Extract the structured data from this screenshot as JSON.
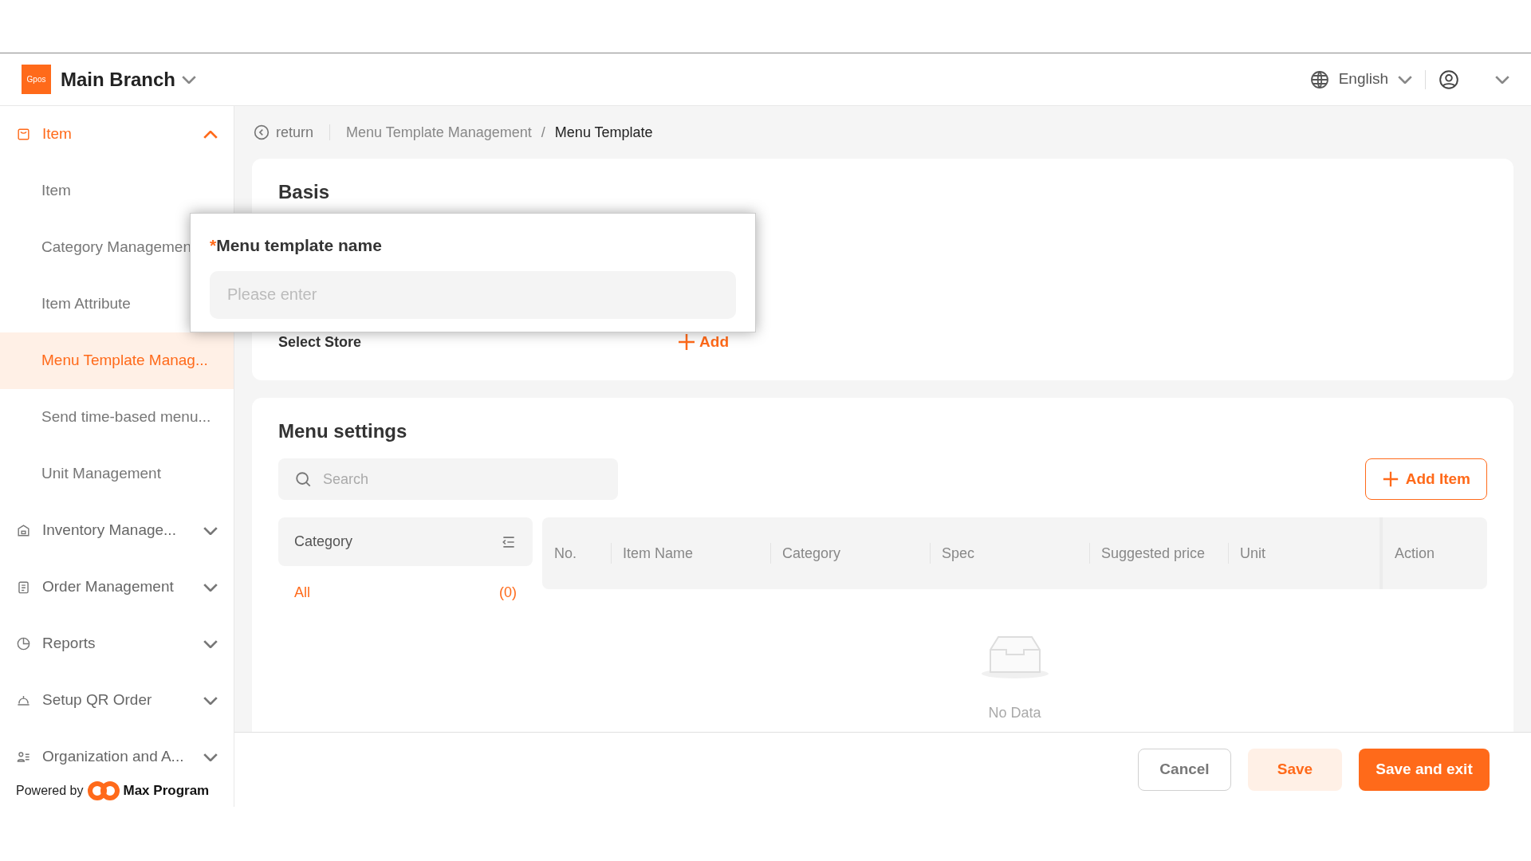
{
  "header": {
    "logo": "Gpos",
    "branch": "Main Branch",
    "language": "English"
  },
  "sidebar": {
    "items": [
      {
        "label": "Item",
        "expanded": true,
        "selected": false,
        "children": [
          {
            "label": "Item",
            "selected": false
          },
          {
            "label": "Category Managemen",
            "selected": false
          },
          {
            "label": "Item Attribute",
            "selected": false
          },
          {
            "label": "Menu Template Manag...",
            "selected": true
          },
          {
            "label": "Send time-based menu...",
            "selected": false
          },
          {
            "label": "Unit Management",
            "selected": false
          }
        ]
      },
      {
        "label": "Inventory Manage...",
        "expanded": false,
        "selected": false
      },
      {
        "label": "Order Management",
        "expanded": false,
        "selected": false
      },
      {
        "label": "Reports",
        "expanded": false,
        "selected": false
      },
      {
        "label": "Setup QR Order",
        "expanded": false,
        "selected": false
      },
      {
        "label": "Organization and A...",
        "expanded": false,
        "selected": false
      }
    ],
    "powered_by": "Powered by",
    "brand": "Max Program"
  },
  "breadcrumb": {
    "back": "return",
    "separator": "/",
    "items": [
      "Menu Template Management",
      "Menu Template"
    ]
  },
  "basis": {
    "title": "Basis",
    "select_store": "Select Store",
    "add": "Add"
  },
  "popup": {
    "required": "*",
    "label": "Menu template name",
    "placeholder": "Please enter"
  },
  "menu_settings": {
    "title": "Menu settings",
    "search_placeholder": "Search",
    "add_item": "Add Item",
    "category_panel": {
      "title": "Category",
      "rows": [
        {
          "label": "All",
          "count": "(0)",
          "selected": true
        }
      ]
    },
    "table": {
      "columns": [
        "No.",
        "Item Name",
        "Category",
        "Spec",
        "Suggested price",
        "Unit",
        "Action"
      ],
      "empty": "No Data"
    }
  },
  "footer": {
    "buttons": [
      {
        "label": "Cancel",
        "kind": "default"
      },
      {
        "label": "Save",
        "kind": "light"
      },
      {
        "label": "Save and exit",
        "kind": "primary"
      }
    ]
  }
}
